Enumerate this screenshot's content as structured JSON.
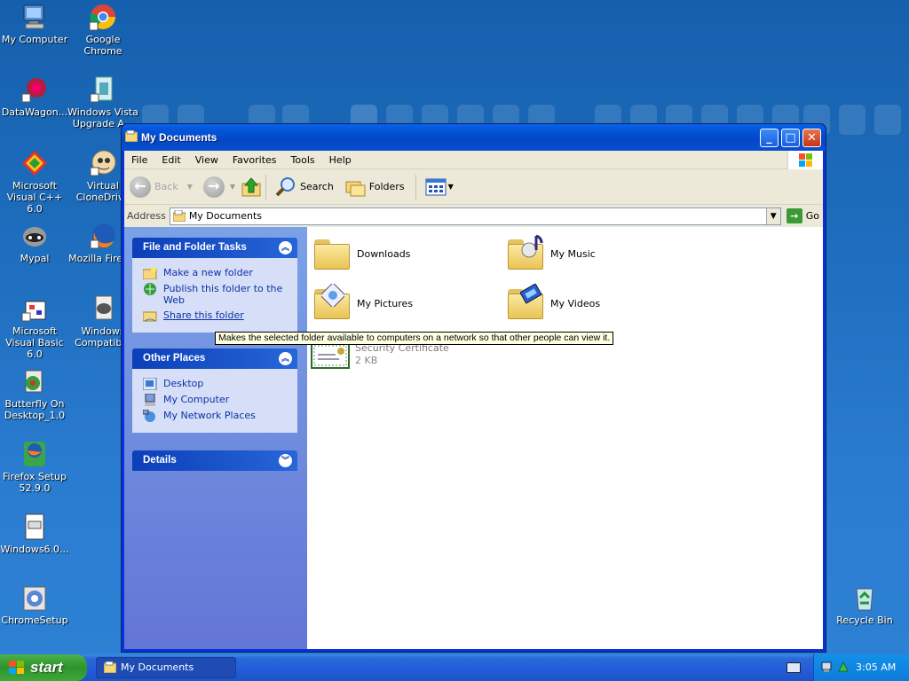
{
  "desktop": {
    "icons": [
      {
        "label": "My Computer"
      },
      {
        "label": "Google Chrome"
      },
      {
        "label": "DataWagon..."
      },
      {
        "label": "Windows Vista Upgrade A..."
      },
      {
        "label": "Microsoft Visual C++ 6.0"
      },
      {
        "label": "Virtual CloneDrive"
      },
      {
        "label": "Mypal"
      },
      {
        "label": "Mozilla Firefox"
      },
      {
        "label": "Microsoft Visual Basic 6.0"
      },
      {
        "label": "Windows Compatib..."
      },
      {
        "label": "Butterfly On Desktop_1.0"
      },
      {
        "label": "Firefox Setup 52.9.0"
      },
      {
        "label": "Windows6.0..."
      },
      {
        "label": "ChromeSetup"
      },
      {
        "label": "Recycle Bin"
      }
    ]
  },
  "window": {
    "title": "My Documents",
    "menu": [
      "File",
      "Edit",
      "View",
      "Favorites",
      "Tools",
      "Help"
    ],
    "toolbar": {
      "back": "Back",
      "search": "Search",
      "folders": "Folders"
    },
    "address": {
      "label": "Address",
      "value": "My Documents",
      "go": "Go"
    },
    "tasks": {
      "file_folder": {
        "title": "File and Folder Tasks",
        "items": [
          "Make a new folder",
          "Publish this folder to the Web",
          "Share this folder"
        ]
      },
      "other_places": {
        "title": "Other Places",
        "items": [
          "Desktop",
          "My Computer",
          "My Network Places"
        ]
      },
      "details": {
        "title": "Details"
      }
    },
    "files": [
      {
        "name": "Downloads",
        "icon": "folder-icon"
      },
      {
        "name": "My Music",
        "icon": "music-folder-icon"
      },
      {
        "name": "My Pictures",
        "icon": "pictures-folder-icon"
      },
      {
        "name": "My Videos",
        "icon": "videos-folder-icon"
      },
      {
        "name": "Security Certificate",
        "size": "2 KB",
        "icon": "certificate-icon"
      }
    ],
    "tooltip": "Makes the selected folder available to computers on a network so that other people can view it."
  },
  "taskbar": {
    "start": "start",
    "task": "My Documents",
    "clock": "3:05 AM"
  }
}
